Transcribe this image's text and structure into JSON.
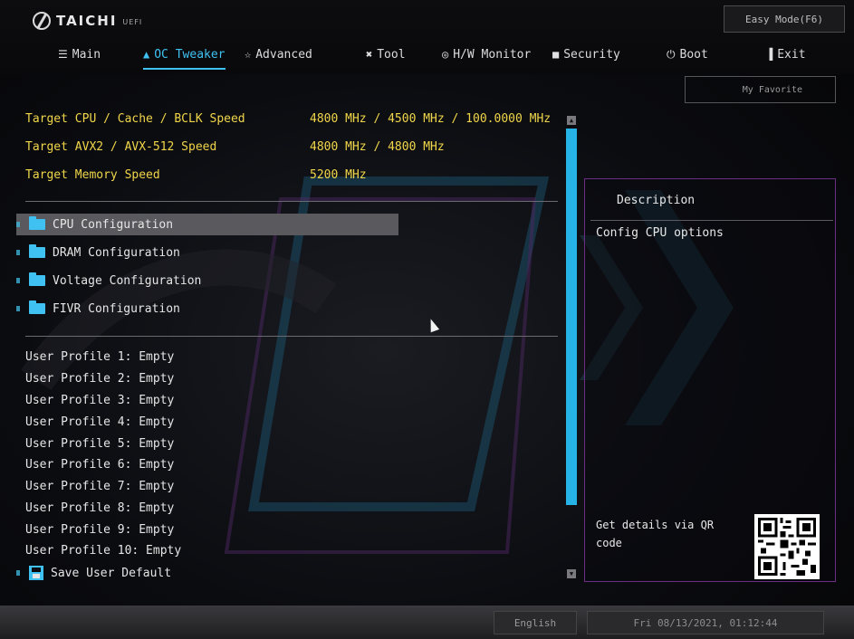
{
  "header": {
    "brand": "TAICHI",
    "brand_suffix": "UEFI",
    "easy_mode_label": "Easy Mode(F6)",
    "my_favorite_label": "My Favorite"
  },
  "tabs": [
    {
      "label": "Main",
      "icon": "list-icon",
      "active": false
    },
    {
      "label": "OC Tweaker",
      "icon": "rocket-icon",
      "active": true
    },
    {
      "label": "Advanced",
      "icon": "star-icon",
      "active": false
    },
    {
      "label": "Tool",
      "icon": "tool-icon",
      "active": false
    },
    {
      "label": "H/W Monitor",
      "icon": "monitor-icon",
      "active": false
    },
    {
      "label": "Security",
      "icon": "shield-icon",
      "active": false
    },
    {
      "label": "Boot",
      "icon": "power-icon",
      "active": false
    },
    {
      "label": "Exit",
      "icon": "exit-icon",
      "active": false
    }
  ],
  "targets": [
    {
      "label": "Target CPU / Cache / BCLK Speed",
      "value": "4800 MHz / 4500 MHz / 100.0000 MHz"
    },
    {
      "label": "Target AVX2 / AVX-512 Speed",
      "value": "4800 MHz / 4800 MHz"
    },
    {
      "label": "Target Memory Speed",
      "value": "5200 MHz"
    }
  ],
  "config_items": [
    {
      "label": "CPU Configuration",
      "selected": true
    },
    {
      "label": "DRAM Configuration",
      "selected": false
    },
    {
      "label": "Voltage Configuration",
      "selected": false
    },
    {
      "label": "FIVR Configuration",
      "selected": false
    }
  ],
  "profiles": [
    "User Profile 1: Empty",
    "User Profile 2: Empty",
    "User Profile 3: Empty",
    "User Profile 4: Empty",
    "User Profile 5: Empty",
    "User Profile 6: Empty",
    "User Profile 7: Empty",
    "User Profile 8: Empty",
    "User Profile 9: Empty",
    "User Profile 10: Empty"
  ],
  "save_default_label": "Save User Default",
  "description": {
    "title": "Description",
    "text": "Config CPU options",
    "qr_text": "Get details via QR code"
  },
  "footer": {
    "language": "English",
    "datetime": "Fri 08/13/2021, 01:12:44"
  },
  "colors": {
    "accent": "#3fc2f2",
    "target_text": "#f0d64a",
    "panel_border": "#6b2d86"
  }
}
